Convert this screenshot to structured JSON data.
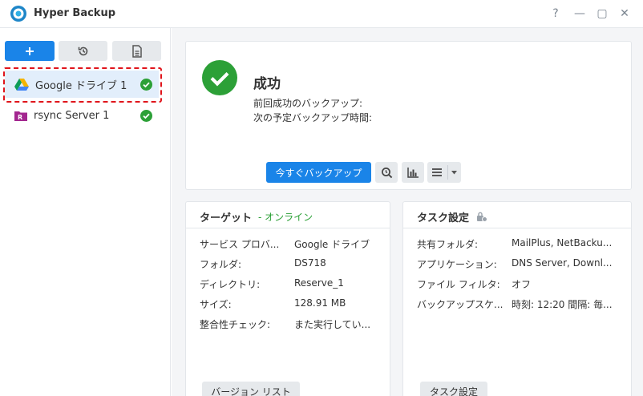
{
  "window": {
    "title": "Hyper Backup",
    "controls": {
      "help": "?",
      "minimize": "—",
      "maximize": "▢",
      "close": "✕"
    }
  },
  "sidebar": {
    "items": [
      {
        "label": "Google ドライブ 1",
        "icon": "google-drive-icon",
        "status": "success"
      },
      {
        "label": "rsync Server 1",
        "icon": "rsync-server-icon",
        "status": "success"
      }
    ]
  },
  "status": {
    "title": "成功",
    "last_backup_label": "前回成功のバックアップ:",
    "next_backup_label": "次の予定バックアップ時間:",
    "backup_now_label": "今すぐバックアップ"
  },
  "target": {
    "title": "ターゲット",
    "state": "- オンライン",
    "rows": [
      {
        "k": "サービス プロバ...",
        "v": "Google ドライブ"
      },
      {
        "k": "フォルダ:",
        "v": "DS718"
      },
      {
        "k": "ディレクトリ:",
        "v": "Reserve_1"
      },
      {
        "k": "サイズ:",
        "v": "128.91 MB"
      },
      {
        "k": "整合性チェック:",
        "v": "また実行してい..."
      }
    ],
    "button": "バージョン リスト"
  },
  "task": {
    "title": "タスク設定",
    "rows": [
      {
        "k": "共有フォルダ:",
        "v": "MailPlus, NetBacku..."
      },
      {
        "k": "アプリケーション:",
        "v": "DNS Server, Downl..."
      },
      {
        "k": "ファイル フィルタ:",
        "v": "オフ"
      },
      {
        "k": "バックアップスケ...",
        "v": "時刻: 12:20 間隔: 毎..."
      }
    ],
    "button": "タスク設定"
  },
  "colors": {
    "accent": "#1a84e8",
    "success": "#2ca037",
    "highlight": "#e0141b"
  }
}
